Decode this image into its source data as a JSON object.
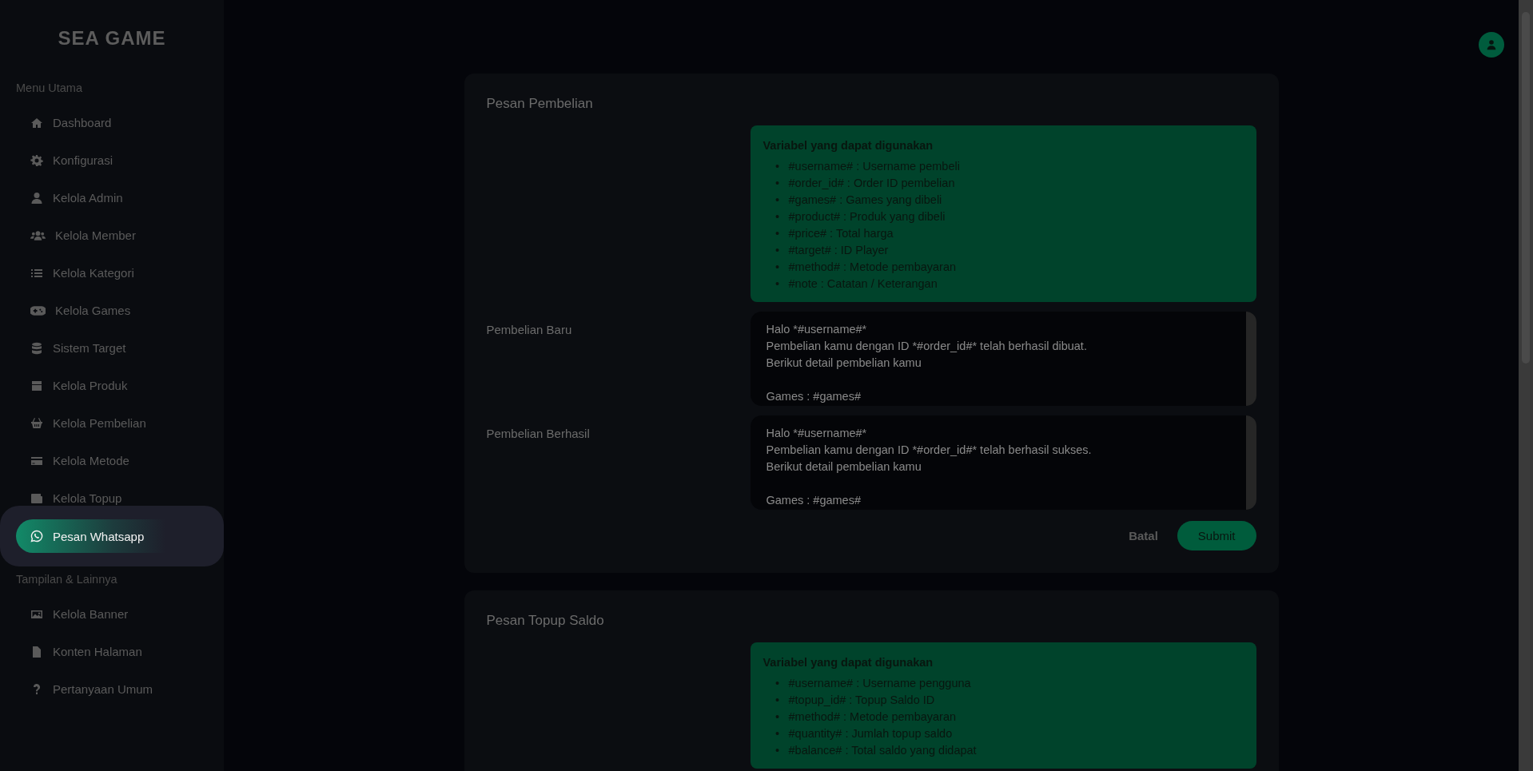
{
  "sidebar": {
    "logo": "SEA GAME",
    "sections": [
      {
        "title": "Menu Utama",
        "items": [
          {
            "label": "Dashboard",
            "kind": "home",
            "selected": false
          },
          {
            "label": "Konfigurasi",
            "kind": "gear",
            "selected": false
          },
          {
            "label": "Kelola Admin",
            "kind": "user",
            "selected": false
          },
          {
            "label": "Kelola Member",
            "kind": "users",
            "selected": false
          },
          {
            "label": "Kelola Kategori",
            "kind": "list",
            "selected": false
          },
          {
            "label": "Kelola Games",
            "kind": "gamepad",
            "selected": false
          },
          {
            "label": "Sistem Target",
            "kind": "database",
            "selected": false
          },
          {
            "label": "Kelola Produk",
            "kind": "box",
            "selected": false
          },
          {
            "label": "Kelola Pembelian",
            "kind": "basket",
            "selected": false
          },
          {
            "label": "Kelola Metode",
            "kind": "card",
            "selected": false
          },
          {
            "label": "Kelola Topup",
            "kind": "wallet",
            "selected": false
          },
          {
            "label": "Pesan Whatsapp",
            "kind": "chat",
            "selected": true
          }
        ]
      },
      {
        "title": "Tampilan & Lainnya",
        "items": [
          {
            "label": "Kelola Banner",
            "kind": "image",
            "selected": false
          },
          {
            "label": "Konten Halaman",
            "kind": "file",
            "selected": false
          },
          {
            "label": "Pertanyaan Umum",
            "kind": "question",
            "selected": false
          }
        ]
      }
    ]
  },
  "cards": [
    {
      "title": "Pesan Pembelian",
      "variables": {
        "title": "Variabel yang dapat digunakan",
        "items": [
          {
            "marker": "•",
            "text": "#username# : Username pembeli"
          },
          {
            "marker": "•",
            "text": "#order_id# : Order ID pembelian"
          },
          {
            "marker": "•",
            "text": "#games# : Games yang dibeli"
          },
          {
            "marker": "•",
            "text": "#product# : Produk yang dibeli"
          },
          {
            "marker": "•",
            "text": "#price# : Total harga"
          },
          {
            "marker": "•",
            "text": "#target# : ID Player"
          },
          {
            "marker": "•",
            "text": "#method# : Metode pembayaran"
          },
          {
            "marker": "•",
            "text": "#note : Catatan / Keterangan"
          }
        ]
      },
      "fields": [
        {
          "label": "Pembelian Baru",
          "value": "Halo *#username#*\nPembelian kamu dengan ID *#order_id#* telah berhasil dibuat.\nBerikut detail pembelian kamu\n\nGames : #games#"
        },
        {
          "label": "Pembelian Berhasil",
          "value": "Halo *#username#*\nPembelian kamu dengan ID *#order_id#* telah berhasil sukses.\nBerikut detail pembelian kamu\n\nGames : #games#"
        }
      ],
      "buttons": {
        "cancel": "Batal",
        "submit": "Submit"
      }
    },
    {
      "title": "Pesan Topup Saldo",
      "variables": {
        "title": "Variabel yang dapat digunakan",
        "items": [
          {
            "marker": "•",
            "text": "#username# : Username pengguna"
          },
          {
            "marker": "•",
            "text": "#topup_id# : Topup Saldo ID"
          },
          {
            "marker": "•",
            "text": "#method# : Metode pembayaran"
          },
          {
            "marker": "•",
            "text": "#quantity# : Jumlah topup saldo"
          },
          {
            "marker": "•",
            "text": "#balance# : Total saldo yang didapat"
          }
        ]
      }
    }
  ]
}
